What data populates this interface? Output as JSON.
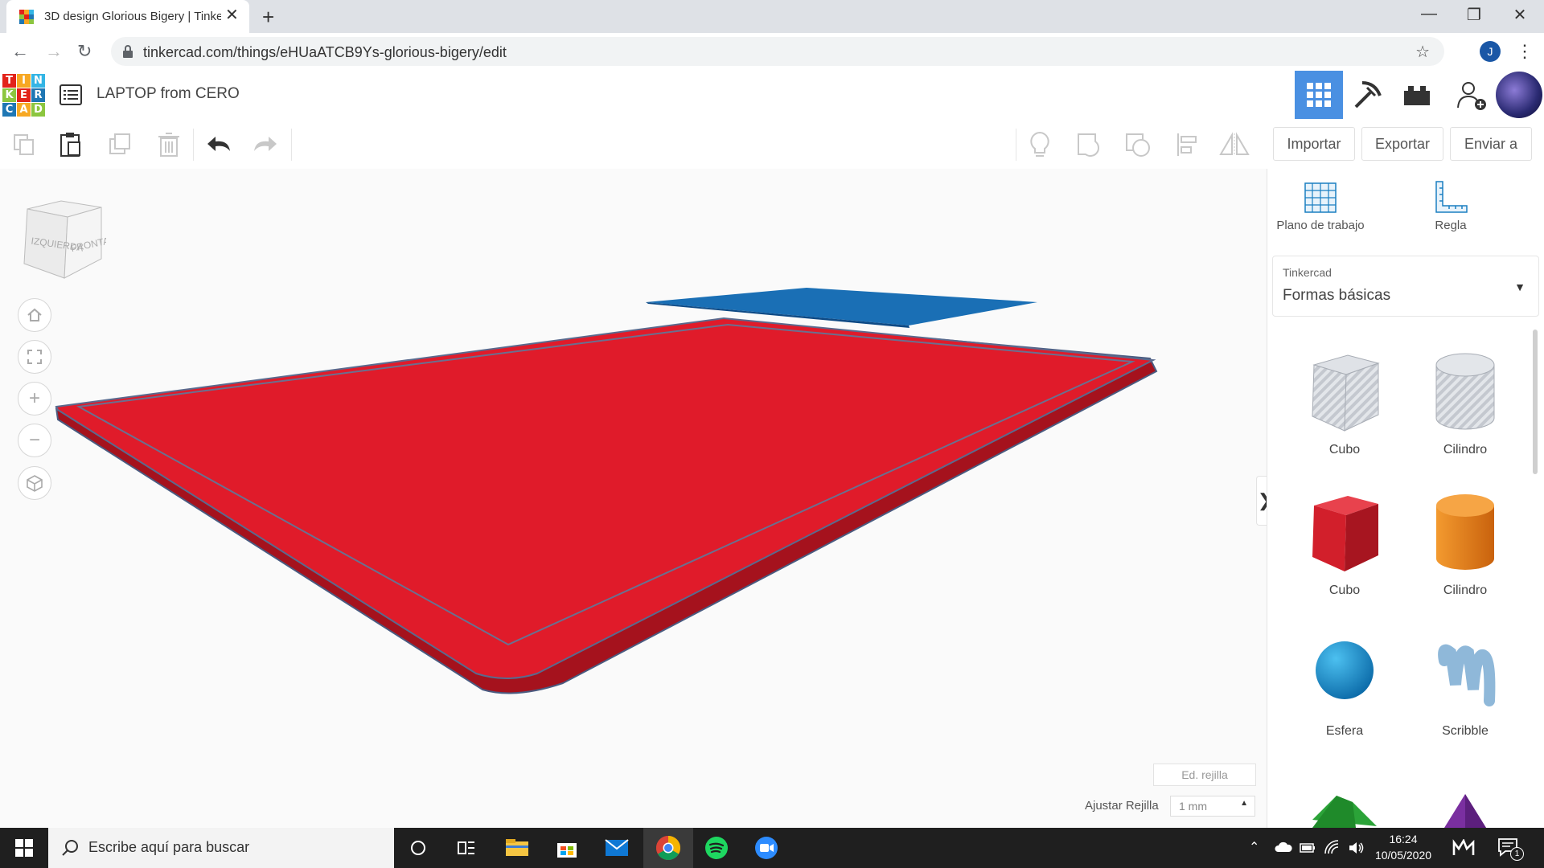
{
  "browser": {
    "tab_title": "3D design Glorious Bigery | Tinke",
    "url": "tinkercad.com/things/eHUaATCB9Ys-glorious-bigery/edit",
    "profile_initial": "J"
  },
  "app": {
    "logo_letters": [
      "T",
      "I",
      "N",
      "K",
      "E",
      "R",
      "C",
      "A",
      "D"
    ],
    "logo_colors": [
      "#e2231a",
      "#f7a823",
      "#33b5e5",
      "#8cc63f",
      "#e2231a",
      "#1f77b4",
      "#1f77b4",
      "#f7a823",
      "#8cc63f"
    ],
    "design_title": "LAPTOP from CERO"
  },
  "toolbar": {
    "import_label": "Importar",
    "export_label": "Exportar",
    "send_label": "Enviar a"
  },
  "viewcube": {
    "left_face": "IZQUIERDA",
    "front_face": "FRONTAL"
  },
  "workspace": {
    "grid_edit_label": "Ed. rejilla",
    "snap_label": "Ajustar Rejilla",
    "snap_value": "1 mm",
    "objects": [
      {
        "name": "red-box",
        "color": "#e01b2a"
      },
      {
        "name": "blue-plate",
        "color": "#1a6fb5"
      }
    ]
  },
  "panel": {
    "workplane_label": "Plano de trabajo",
    "ruler_label": "Regla",
    "library_source": "Tinkercad",
    "library_value": "Formas básicas",
    "shapes": [
      {
        "label": "Cubo",
        "color": "#b8bcc4",
        "kind": "cube-hole"
      },
      {
        "label": "Cilindro",
        "color": "#b8bcc4",
        "kind": "cylinder-hole"
      },
      {
        "label": "Cubo",
        "color": "#d21f2b",
        "kind": "cube"
      },
      {
        "label": "Cilindro",
        "color": "#e8801a",
        "kind": "cylinder"
      },
      {
        "label": "Esfera",
        "color": "#1a8fd1",
        "kind": "sphere"
      },
      {
        "label": "Scribble",
        "color": "#8fb8d9",
        "kind": "scribble"
      }
    ]
  },
  "taskbar": {
    "search_placeholder": "Escribe aquí para buscar",
    "time": "16:24",
    "date": "10/05/2020",
    "notification_count": "1"
  }
}
